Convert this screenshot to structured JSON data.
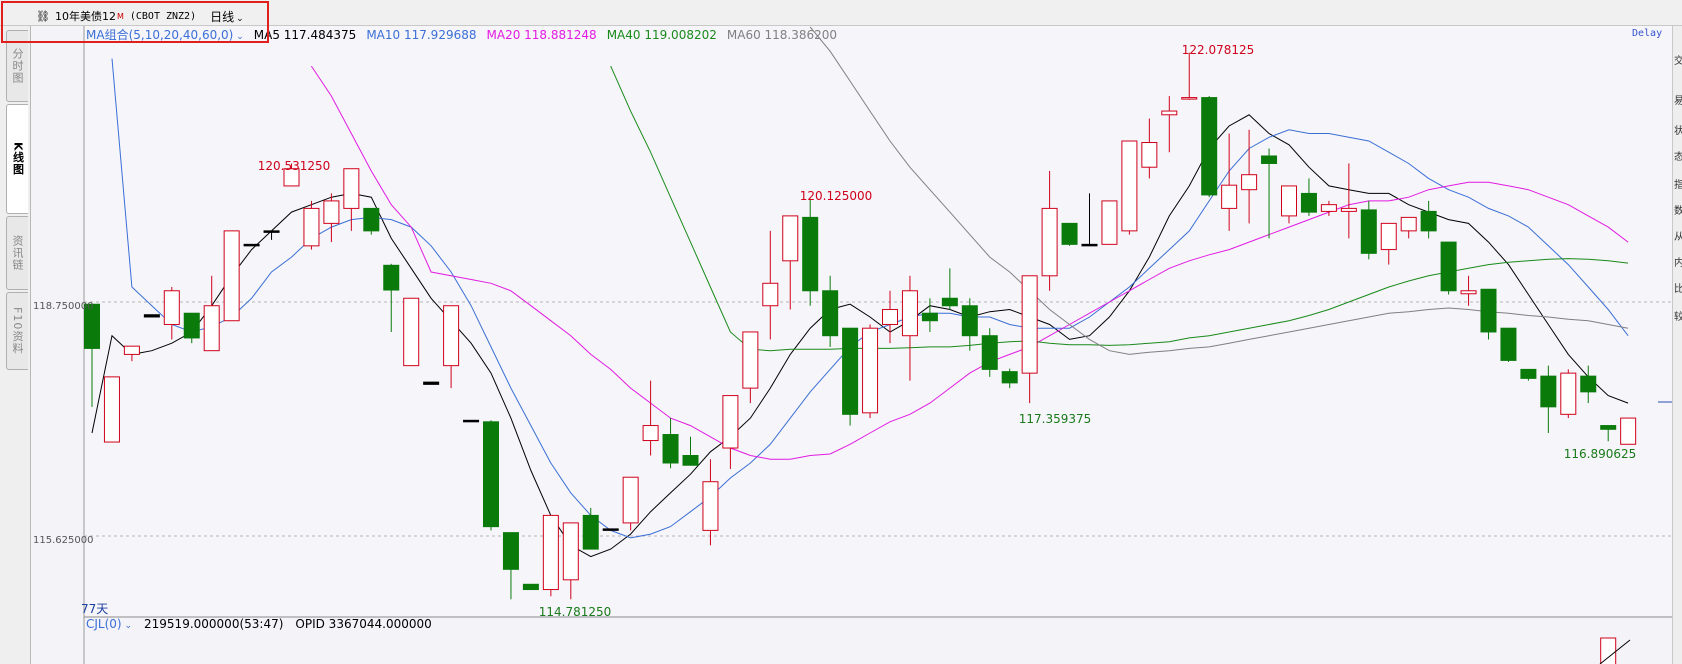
{
  "header": {
    "link_icon": "link-icon",
    "title": "10年美债12",
    "title_badge": "M",
    "code": "(CBOT ZNZ2)",
    "period": "日线"
  },
  "left_tabs": [
    {
      "label": "分时图",
      "active": false
    },
    {
      "label": "K线图",
      "active": true
    },
    {
      "label": "资讯链",
      "active": false
    },
    {
      "label": "F10资料",
      "active": false
    }
  ],
  "legend": {
    "combo": "MA组合(5,10,20,40,60,0)",
    "items": [
      {
        "label": "MA5 117.484375",
        "color": "#000000"
      },
      {
        "label": "MA10 117.929688",
        "color": "#3b6fd6"
      },
      {
        "label": "MA20 118.881248",
        "color": "#e21be2"
      },
      {
        "label": "MA40 119.008202",
        "color": "#1a8a1a"
      },
      {
        "label": "MA60 118.386200",
        "color": "#808080"
      }
    ]
  },
  "status": {
    "delay": "Delay"
  },
  "axis": {
    "y_labels": [
      "118.750000",
      "115.625000"
    ],
    "days_label": "77天"
  },
  "annotations": [
    {
      "text": "120.531250",
      "kind": "up"
    },
    {
      "text": "120.125000",
      "kind": "up"
    },
    {
      "text": "122.078125",
      "kind": "up"
    },
    {
      "text": "114.781250",
      "kind": "down"
    },
    {
      "text": "117.359375",
      "kind": "down"
    },
    {
      "text": "116.890625",
      "kind": "down"
    }
  ],
  "volume": {
    "indicator": "CJL(0)",
    "value": "219519.000000(53:47)",
    "opid": "OPID 3367044.000000"
  },
  "right_panel_chars": [
    "交",
    "易",
    "状",
    "态",
    "指",
    "数",
    "从",
    "内",
    "比",
    "较"
  ],
  "colors": {
    "up": "#d0021b",
    "down": "#0a7a0a",
    "accent_red": "#e0201c"
  },
  "chart_data": {
    "type": "candlestick",
    "candles": [
      {
        "o": 118.72,
        "h": 118.72,
        "l": 117.35,
        "c": 118.13,
        "d": "down"
      },
      {
        "o": 116.88,
        "h": 117.75,
        "l": 116.88,
        "c": 117.75,
        "d": "up"
      },
      {
        "o": 118.05,
        "h": 118.16,
        "l": 117.96,
        "c": 118.16,
        "d": "up"
      },
      {
        "o": 118.55,
        "h": 118.58,
        "l": 118.55,
        "c": 118.58,
        "d": "flat"
      },
      {
        "o": 118.45,
        "h": 118.95,
        "l": 118.25,
        "c": 118.9,
        "d": "up"
      },
      {
        "o": 118.6,
        "h": 118.6,
        "l": 118.2,
        "c": 118.27,
        "d": "down"
      },
      {
        "o": 118.1,
        "h": 119.1,
        "l": 118.1,
        "c": 118.7,
        "d": "up"
      },
      {
        "o": 118.5,
        "h": 119.5,
        "l": 118.5,
        "c": 119.7,
        "d": "up"
      },
      {
        "o": 119.5,
        "h": 119.5,
        "l": 119.5,
        "c": 119.52,
        "d": "flat"
      },
      {
        "o": 119.7,
        "h": 119.7,
        "l": 119.58,
        "c": 119.7,
        "d": "flat"
      },
      {
        "o": 120.3,
        "h": 120.6,
        "l": 120.3,
        "c": 120.53,
        "d": "up"
      },
      {
        "o": 119.5,
        "h": 120.1,
        "l": 119.45,
        "c": 120.0,
        "d": "up"
      },
      {
        "o": 119.8,
        "h": 120.2,
        "l": 119.55,
        "c": 120.1,
        "d": "up"
      },
      {
        "o": 120.0,
        "h": 120.53,
        "l": 119.7,
        "c": 120.53,
        "d": "up"
      },
      {
        "o": 120.0,
        "h": 120.0,
        "l": 119.65,
        "c": 119.7,
        "d": "down"
      },
      {
        "o": 119.24,
        "h": 119.26,
        "l": 118.35,
        "c": 118.91,
        "d": "down"
      },
      {
        "o": 117.9,
        "h": 118.8,
        "l": 117.9,
        "c": 118.8,
        "d": "up"
      },
      {
        "o": 117.65,
        "h": 117.68,
        "l": 117.65,
        "c": 117.68,
        "d": "flat"
      },
      {
        "o": 117.9,
        "h": 118.7,
        "l": 117.6,
        "c": 118.7,
        "d": "up"
      },
      {
        "o": 117.17,
        "h": 117.17,
        "l": 117.15,
        "c": 117.17,
        "d": "flat"
      },
      {
        "o": 117.15,
        "h": 117.17,
        "l": 115.7,
        "c": 115.75,
        "d": "down"
      },
      {
        "o": 115.67,
        "h": 115.6,
        "l": 114.78,
        "c": 115.18,
        "d": "down"
      },
      {
        "o": 114.98,
        "h": 114.98,
        "l": 114.91,
        "c": 114.91,
        "d": "down"
      },
      {
        "o": 114.91,
        "h": 115.9,
        "l": 114.82,
        "c": 115.9,
        "d": "up"
      },
      {
        "o": 115.04,
        "h": 115.8,
        "l": 114.78,
        "c": 115.8,
        "d": "up"
      },
      {
        "o": 115.9,
        "h": 116.0,
        "l": 115.45,
        "c": 115.45,
        "d": "down"
      },
      {
        "o": 115.7,
        "h": 115.72,
        "l": 115.7,
        "c": 115.72,
        "d": "flat"
      },
      {
        "o": 115.8,
        "h": 116.41,
        "l": 115.7,
        "c": 116.41,
        "d": "up"
      },
      {
        "o": 116.9,
        "h": 117.7,
        "l": 116.7,
        "c": 117.1,
        "d": "up"
      },
      {
        "o": 116.98,
        "h": 117.2,
        "l": 116.53,
        "c": 116.6,
        "d": "down"
      },
      {
        "o": 116.7,
        "h": 116.95,
        "l": 116.6,
        "c": 116.57,
        "d": "down"
      },
      {
        "o": 115.7,
        "h": 116.65,
        "l": 115.5,
        "c": 116.35,
        "d": "up"
      },
      {
        "o": 116.8,
        "h": 117.5,
        "l": 116.52,
        "c": 117.5,
        "d": "up"
      },
      {
        "o": 117.6,
        "h": 118.35,
        "l": 117.4,
        "c": 118.35,
        "d": "up"
      },
      {
        "o": 118.7,
        "h": 119.7,
        "l": 118.25,
        "c": 119.0,
        "d": "up"
      },
      {
        "o": 119.3,
        "h": 119.9,
        "l": 118.65,
        "c": 119.9,
        "d": "up"
      },
      {
        "o": 119.88,
        "h": 120.13,
        "l": 118.7,
        "c": 118.9,
        "d": "down"
      },
      {
        "o": 118.9,
        "h": 119.1,
        "l": 118.15,
        "c": 118.3,
        "d": "down"
      },
      {
        "o": 118.4,
        "h": 118.4,
        "l": 117.1,
        "c": 117.25,
        "d": "down"
      },
      {
        "o": 117.27,
        "h": 118.45,
        "l": 117.2,
        "c": 118.4,
        "d": "up"
      },
      {
        "o": 118.45,
        "h": 118.9,
        "l": 118.2,
        "c": 118.65,
        "d": "up"
      },
      {
        "o": 118.3,
        "h": 119.1,
        "l": 117.7,
        "c": 118.9,
        "d": "up"
      },
      {
        "o": 118.6,
        "h": 118.8,
        "l": 118.35,
        "c": 118.5,
        "d": "down"
      },
      {
        "o": 118.8,
        "h": 119.2,
        "l": 118.65,
        "c": 118.7,
        "d": "down"
      },
      {
        "o": 118.7,
        "h": 118.8,
        "l": 118.1,
        "c": 118.3,
        "d": "down"
      },
      {
        "o": 118.3,
        "h": 118.4,
        "l": 117.75,
        "c": 117.85,
        "d": "down"
      },
      {
        "o": 117.82,
        "h": 117.86,
        "l": 117.6,
        "c": 117.67,
        "d": "down"
      },
      {
        "o": 117.8,
        "h": 119.1,
        "l": 117.4,
        "c": 119.1,
        "d": "up"
      },
      {
        "o": 119.1,
        "h": 120.5,
        "l": 118.9,
        "c": 120.0,
        "d": "up"
      },
      {
        "o": 119.8,
        "h": 119.8,
        "l": 119.5,
        "c": 119.52,
        "d": "down"
      },
      {
        "o": 119.5,
        "h": 120.2,
        "l": 119.5,
        "c": 119.52,
        "d": "flat"
      },
      {
        "o": 119.52,
        "h": 120.1,
        "l": 119.55,
        "c": 120.1,
        "d": "up"
      },
      {
        "o": 119.7,
        "h": 120.9,
        "l": 119.65,
        "c": 120.9,
        "d": "up"
      },
      {
        "o": 120.55,
        "h": 121.2,
        "l": 120.4,
        "c": 120.88,
        "d": "up"
      },
      {
        "o": 121.25,
        "h": 121.5,
        "l": 120.75,
        "c": 121.3,
        "d": "up"
      },
      {
        "o": 121.48,
        "h": 122.08,
        "l": 121.45,
        "c": 121.48,
        "d": "up"
      },
      {
        "o": 121.48,
        "h": 121.5,
        "l": 120.15,
        "c": 120.18,
        "d": "down"
      },
      {
        "o": 120.0,
        "h": 121.0,
        "l": 119.7,
        "c": 120.31,
        "d": "up"
      },
      {
        "o": 120.25,
        "h": 121.05,
        "l": 119.8,
        "c": 120.45,
        "d": "up"
      },
      {
        "o": 120.6,
        "h": 120.8,
        "l": 119.6,
        "c": 120.7,
        "d": "down"
      },
      {
        "o": 119.9,
        "h": 120.3,
        "l": 119.8,
        "c": 120.3,
        "d": "up"
      },
      {
        "o": 120.2,
        "h": 120.4,
        "l": 119.9,
        "c": 119.95,
        "d": "down"
      },
      {
        "o": 119.96,
        "h": 120.1,
        "l": 119.9,
        "c": 120.05,
        "d": "up"
      },
      {
        "o": 120.0,
        "h": 120.6,
        "l": 119.6,
        "c": 119.96,
        "d": "up"
      },
      {
        "o": 119.98,
        "h": 120.1,
        "l": 119.32,
        "c": 119.4,
        "d": "down"
      },
      {
        "o": 119.45,
        "h": 119.8,
        "l": 119.25,
        "c": 119.8,
        "d": "up"
      },
      {
        "o": 119.88,
        "h": 119.8,
        "l": 119.6,
        "c": 119.7,
        "d": "up"
      },
      {
        "o": 119.96,
        "h": 120.1,
        "l": 119.6,
        "c": 119.7,
        "d": "down"
      },
      {
        "o": 119.55,
        "h": 119.5,
        "l": 118.85,
        "c": 118.9,
        "d": "down"
      },
      {
        "o": 118.86,
        "h": 119.1,
        "l": 118.7,
        "c": 118.9,
        "d": "up"
      },
      {
        "o": 118.92,
        "h": 118.92,
        "l": 118.25,
        "c": 118.35,
        "d": "down"
      },
      {
        "o": 118.4,
        "h": 118.4,
        "l": 117.95,
        "c": 117.97,
        "d": "down"
      },
      {
        "o": 117.85,
        "h": 117.85,
        "l": 117.7,
        "c": 117.73,
        "d": "down"
      },
      {
        "o": 117.76,
        "h": 117.9,
        "l": 117.0,
        "c": 117.35,
        "d": "down"
      },
      {
        "o": 117.25,
        "h": 117.85,
        "l": 117.2,
        "c": 117.8,
        "d": "up"
      },
      {
        "o": 117.76,
        "h": 117.9,
        "l": 117.4,
        "c": 117.55,
        "d": "down"
      },
      {
        "o": 117.1,
        "h": 117.05,
        "l": 116.89,
        "c": 117.05,
        "d": "down"
      },
      {
        "o": 116.85,
        "h": 117.2,
        "l": 116.95,
        "c": 117.2,
        "d": "up"
      }
    ],
    "ma5": [
      117.0,
      118.3,
      118.05,
      118.1,
      118.2,
      118.35,
      118.7,
      119.1,
      119.45,
      119.7,
      119.95,
      120.05,
      120.15,
      120.2,
      120.15,
      119.6,
      119.2,
      118.8,
      118.5,
      118.2,
      117.8,
      117.2,
      116.5,
      115.9,
      115.5,
      115.35,
      115.45,
      115.65,
      115.95,
      116.2,
      116.45,
      116.75,
      116.95,
      117.2,
      117.6,
      118.05,
      118.4,
      118.65,
      118.72,
      118.55,
      118.35,
      118.5,
      118.7,
      118.65,
      118.55,
      118.62,
      118.65,
      118.55,
      118.45,
      118.25,
      118.3,
      118.55,
      118.9,
      119.35,
      119.9,
      120.3,
      120.8,
      121.1,
      121.25,
      121.0,
      120.85,
      120.55,
      120.3,
      120.25,
      120.2,
      120.2,
      120.05,
      119.95,
      119.85,
      119.8,
      119.55,
      119.25,
      118.85,
      118.45,
      118.05,
      117.75,
      117.5,
      117.4
    ],
    "ma10": [
      null,
      122.0,
      118.95,
      118.7,
      118.45,
      118.35,
      118.42,
      118.55,
      118.8,
      119.15,
      119.35,
      119.6,
      119.75,
      119.85,
      119.88,
      119.85,
      119.75,
      119.5,
      119.15,
      118.7,
      118.15,
      117.6,
      117.1,
      116.6,
      116.2,
      115.9,
      115.7,
      115.6,
      115.65,
      115.75,
      115.95,
      116.15,
      116.4,
      116.6,
      116.85,
      117.2,
      117.55,
      117.85,
      118.15,
      118.35,
      118.45,
      118.55,
      118.6,
      118.6,
      118.55,
      118.55,
      118.45,
      118.4,
      118.4,
      118.4,
      118.55,
      118.75,
      118.95,
      119.2,
      119.45,
      119.7,
      120.1,
      120.5,
      120.8,
      120.95,
      121.05,
      121.0,
      121.0,
      120.95,
      120.9,
      120.75,
      120.6,
      120.4,
      120.25,
      120.15,
      120.0,
      119.9,
      119.75,
      119.5,
      119.25,
      118.95,
      118.65,
      118.3
    ],
    "ma20": [
      null,
      null,
      null,
      null,
      null,
      null,
      null,
      null,
      null,
      null,
      null,
      121.9,
      121.5,
      121.0,
      120.5,
      120.05,
      119.75,
      119.15,
      119.1,
      119.05,
      119.0,
      118.9,
      118.7,
      118.5,
      118.3,
      118.05,
      117.85,
      117.6,
      117.4,
      117.2,
      117.1,
      116.95,
      116.8,
      116.7,
      116.65,
      116.65,
      116.7,
      116.72,
      116.85,
      117.0,
      117.15,
      117.25,
      117.4,
      117.6,
      117.8,
      117.95,
      118.05,
      118.15,
      118.3,
      118.45,
      118.6,
      118.75,
      118.9,
      119.05,
      119.2,
      119.3,
      119.38,
      119.45,
      119.55,
      119.65,
      119.75,
      119.85,
      119.95,
      120.05,
      120.1,
      120.1,
      120.15,
      120.25,
      120.3,
      120.35,
      120.35,
      120.3,
      120.25,
      120.15,
      120.05,
      119.9,
      119.75,
      119.55
    ],
    "ma40": [
      null,
      null,
      null,
      null,
      null,
      null,
      null,
      null,
      null,
      null,
      null,
      null,
      null,
      null,
      null,
      null,
      null,
      null,
      null,
      null,
      null,
      null,
      null,
      null,
      null,
      null,
      121.9,
      121.3,
      120.75,
      120.15,
      119.55,
      118.95,
      118.35,
      118.12,
      118.1,
      118.12,
      118.12,
      118.12,
      118.13,
      118.13,
      118.13,
      118.14,
      118.15,
      118.15,
      118.17,
      118.2,
      118.22,
      118.23,
      118.2,
      118.18,
      118.18,
      118.17,
      118.18,
      118.2,
      118.22,
      118.27,
      118.3,
      118.35,
      118.4,
      118.45,
      118.5,
      118.57,
      118.65,
      118.75,
      118.85,
      118.95,
      119.03,
      119.1,
      119.15,
      119.2,
      119.25,
      119.28,
      119.3,
      119.32,
      119.33,
      119.32,
      119.3,
      119.27
    ],
    "ma60": [
      null,
      null,
      null,
      null,
      null,
      null,
      null,
      null,
      null,
      null,
      null,
      null,
      null,
      null,
      null,
      null,
      null,
      null,
      null,
      null,
      null,
      null,
      null,
      null,
      null,
      null,
      null,
      null,
      null,
      null,
      null,
      null,
      null,
      null,
      null,
      null,
      122.5,
      122.1,
      121.7,
      121.3,
      120.9,
      120.55,
      120.25,
      119.95,
      119.65,
      119.35,
      119.15,
      118.9,
      118.65,
      118.45,
      118.25,
      118.1,
      118.05,
      118.08,
      118.1,
      118.13,
      118.15,
      118.2,
      118.25,
      118.3,
      118.35,
      118.4,
      118.45,
      118.5,
      118.55,
      118.6,
      118.62,
      118.65,
      118.67,
      118.65,
      118.62,
      118.6,
      118.57,
      118.55,
      118.52,
      118.5,
      118.45,
      118.4
    ],
    "yticks": [
      118.75,
      115.625
    ],
    "grid": true,
    "volume_visible": [
      {
        "index": 76,
        "kind": "up"
      }
    ]
  }
}
